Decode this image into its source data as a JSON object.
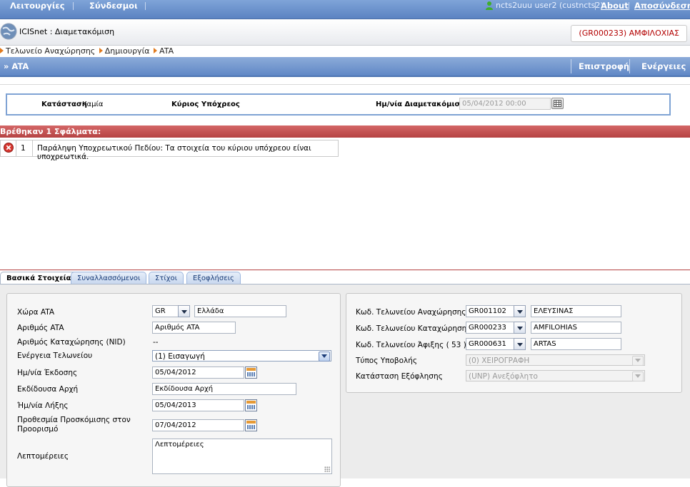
{
  "topbar": {
    "menu1": "Λειτουργίες",
    "menu2": "Σύνδεσμοι",
    "user": "ncts2uuu user2 (custncts2)",
    "about": "About",
    "logout": "Αποσύνδεση"
  },
  "app": {
    "title": "ICISnet : Διαμετακόμιση",
    "customs_office": "(GR000233) ΑΜΦΙΛΟΧΙΑΣ"
  },
  "breadcrumb": [
    "Τελωνείο Αναχώρησης",
    "Δημιουργία",
    "ATA"
  ],
  "titlebar": {
    "title": "» ATA",
    "back": "Επιστροφή",
    "actions": "Ενέργειες"
  },
  "status": {
    "state_label": "Κατάσταση",
    "state_value": "Καμία",
    "principal_label": "Κύριος Υπόχρεος",
    "date_label": "Ημ/νία Διαμετακόμισης",
    "date_value": "05/04/2012 00:00"
  },
  "errors": {
    "header": "Βρέθηκαν 1 Σφάλματα:",
    "rows": [
      {
        "num": "1",
        "text": "Παράληψη Υποχρεωτικού Πεδίου: Τα στοιχεία του κύριου υπόχρεου είναι υποχρεωτικά."
      }
    ]
  },
  "tabs": [
    "Βασικά Στοιχεία",
    "Συναλλασσόμενοι",
    "Στίχοι",
    "Εξοφλήσεις"
  ],
  "left_form": {
    "country_label": "Χώρα ATA",
    "country_code": "GR",
    "country_name": "Ελλάδα",
    "ata_num_label": "Αριθμός ATA",
    "ata_num_value": "Αριθμός ATA",
    "nid_label": "Αριθμός Καταχώρησης (NID)",
    "nid_value": "--",
    "action_label": "Ενέργεια Τελωνείου",
    "action_value": "(1) Εισαγωγή",
    "issue_label": "Ημ/νία Έκδοσης",
    "issue_value": "05/04/2012",
    "authority_label": "Εκδίδουσα Αρχή",
    "authority_value": "Εκδίδουσα Αρχή",
    "expiry_label": "Ήμ/νία Λήξης",
    "expiry_value": "05/04/2013",
    "deadline_label": "Προθεσμία Προσκόμισης στον Προορισμό",
    "deadline_value": "07/04/2012",
    "details_label": "Λεπτομέρειες",
    "details_value": "Λεπτομέρειες"
  },
  "right_form": {
    "departure_label": "Κωδ. Τελωνείου Αναχώρησης",
    "departure_code": "GR001102",
    "departure_name": "ΕΛΕΥΣΙΝΑΣ",
    "registration_label": "Κωδ. Τελωνείου Καταχώρησης",
    "registration_code": "GR000233",
    "registration_name": "AMFILOHIAS",
    "arrival_label": "Κωδ. Τελωνείου Άφιξης ( 53 )",
    "arrival_code": "GR000631",
    "arrival_name": "ARTAS",
    "submit_type_label": "Τύπος Υποβολής",
    "submit_type_value": "(0) ΧΕΙΡΟΓΡΑΦΗ",
    "settlement_label": "Κατάσταση Εξόφλησης",
    "settlement_value": "(UNP) Ανεξόφλητο"
  }
}
